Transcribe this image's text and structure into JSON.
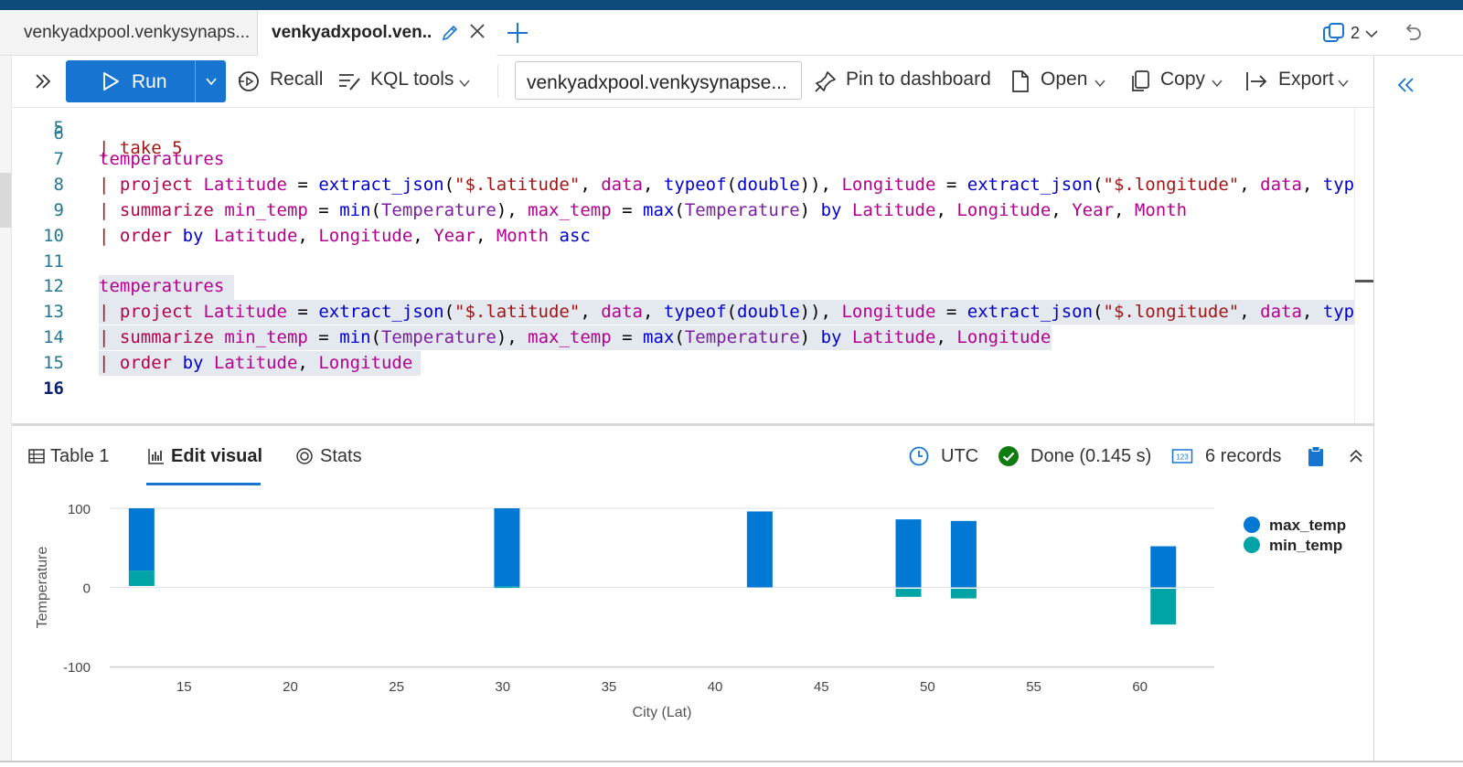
{
  "tabs": {
    "tab1_label": "venkyadxpool.venkysynaps...",
    "tab2_label": "venkyadxpool.ven...",
    "window_count": "2"
  },
  "toolbar": {
    "run_label": "Run",
    "recall_label": "Recall",
    "kql_tools_label": "KQL tools",
    "database": "venkyadxpool.venkysynapse...",
    "pin_label": "Pin to dashboard",
    "open_label": "Open",
    "copy_label": "Copy",
    "export_label": "Export"
  },
  "editor": {
    "partial_line_text": "| take 5",
    "line_numbers": [
      "6",
      "7",
      "8",
      "9",
      "10",
      "11",
      "12",
      "13",
      "14",
      "15",
      "16"
    ],
    "lines": [
      "",
      "temperatures",
      "| project Latitude = extract_json(\"$.latitude\", data, typeof(double)), Longitude = extract_json(\"$.longitude\", data, typeof",
      "| summarize min_temp = min(Temperature), max_temp = max(Temperature) by Latitude, Longitude, Year, Month",
      "| order by Latitude, Longitude, Year, Month asc",
      "",
      "temperatures",
      "| project Latitude = extract_json(\"$.latitude\", data, typeof(double)), Longitude = extract_json(\"$.longitude\", data, typeof",
      "| summarize min_temp = min(Temperature), max_temp = max(Temperature) by Latitude, Longitude",
      "| order by Latitude, Longitude",
      ""
    ]
  },
  "results": {
    "tab_table": "Table 1",
    "tab_visual": "Edit visual",
    "tab_stats": "Stats",
    "timezone": "UTC",
    "status": "Done (0.145 s)",
    "records_icon_text": "123",
    "records": "6 records"
  },
  "colors": {
    "accent": "#1774d0",
    "max_temp": "#0078d4",
    "min_temp": "#00a4a7",
    "done": "#107c10"
  },
  "chart_data": {
    "type": "bar",
    "stacked": true,
    "xlabel": "City (Lat)",
    "ylabel": "Temperature",
    "xlim": [
      11.5,
      63.5
    ],
    "ylim": [
      -100,
      100
    ],
    "xticks": [
      15,
      20,
      25,
      30,
      35,
      40,
      45,
      50,
      55,
      60
    ],
    "yticks": [
      100,
      0,
      -100
    ],
    "legend": "right",
    "grid": true,
    "x": [
      13.0,
      30.2,
      42.1,
      49.1,
      51.7,
      61.1
    ],
    "series": [
      {
        "name": "max_temp",
        "color": "#0078d4",
        "values": [
          100,
          100,
          96,
          86,
          84,
          52
        ]
      },
      {
        "name": "min_temp",
        "color": "#00a4a7",
        "values": [
          21,
          1,
          0,
          -12,
          -14,
          -47
        ]
      }
    ]
  }
}
